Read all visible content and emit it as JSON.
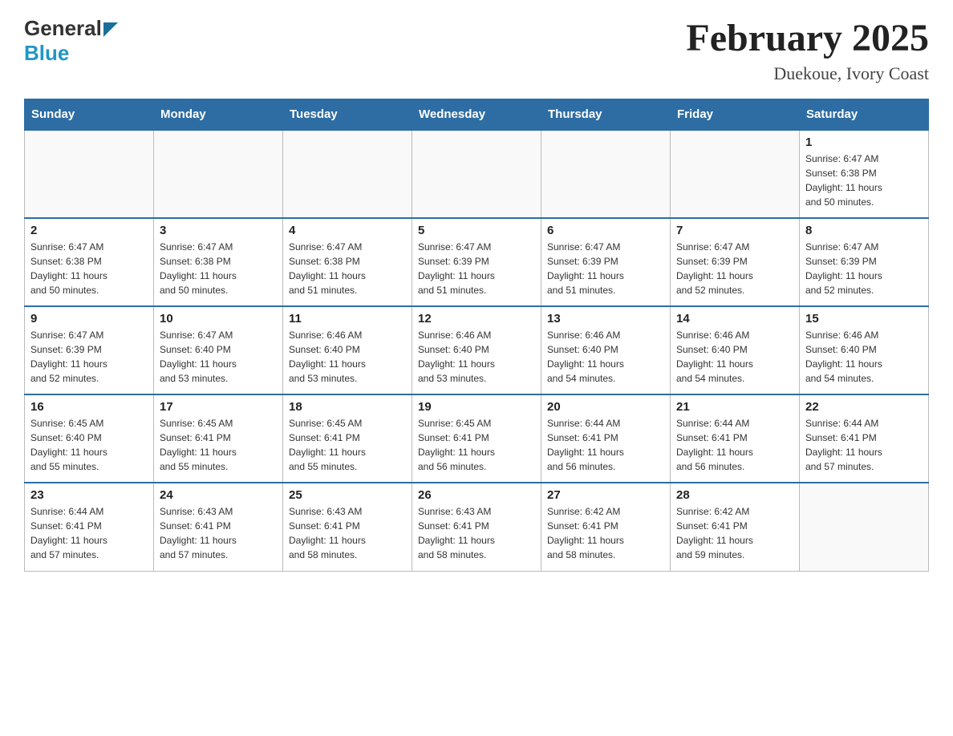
{
  "header": {
    "title": "February 2025",
    "subtitle": "Duekoue, Ivory Coast",
    "logo_general": "General",
    "logo_blue": "Blue"
  },
  "days_of_week": [
    "Sunday",
    "Monday",
    "Tuesday",
    "Wednesday",
    "Thursday",
    "Friday",
    "Saturday"
  ],
  "weeks": [
    {
      "days": [
        {
          "number": "",
          "info": ""
        },
        {
          "number": "",
          "info": ""
        },
        {
          "number": "",
          "info": ""
        },
        {
          "number": "",
          "info": ""
        },
        {
          "number": "",
          "info": ""
        },
        {
          "number": "",
          "info": ""
        },
        {
          "number": "1",
          "info": "Sunrise: 6:47 AM\nSunset: 6:38 PM\nDaylight: 11 hours\nand 50 minutes."
        }
      ]
    },
    {
      "days": [
        {
          "number": "2",
          "info": "Sunrise: 6:47 AM\nSunset: 6:38 PM\nDaylight: 11 hours\nand 50 minutes."
        },
        {
          "number": "3",
          "info": "Sunrise: 6:47 AM\nSunset: 6:38 PM\nDaylight: 11 hours\nand 50 minutes."
        },
        {
          "number": "4",
          "info": "Sunrise: 6:47 AM\nSunset: 6:38 PM\nDaylight: 11 hours\nand 51 minutes."
        },
        {
          "number": "5",
          "info": "Sunrise: 6:47 AM\nSunset: 6:39 PM\nDaylight: 11 hours\nand 51 minutes."
        },
        {
          "number": "6",
          "info": "Sunrise: 6:47 AM\nSunset: 6:39 PM\nDaylight: 11 hours\nand 51 minutes."
        },
        {
          "number": "7",
          "info": "Sunrise: 6:47 AM\nSunset: 6:39 PM\nDaylight: 11 hours\nand 52 minutes."
        },
        {
          "number": "8",
          "info": "Sunrise: 6:47 AM\nSunset: 6:39 PM\nDaylight: 11 hours\nand 52 minutes."
        }
      ]
    },
    {
      "days": [
        {
          "number": "9",
          "info": "Sunrise: 6:47 AM\nSunset: 6:39 PM\nDaylight: 11 hours\nand 52 minutes."
        },
        {
          "number": "10",
          "info": "Sunrise: 6:47 AM\nSunset: 6:40 PM\nDaylight: 11 hours\nand 53 minutes."
        },
        {
          "number": "11",
          "info": "Sunrise: 6:46 AM\nSunset: 6:40 PM\nDaylight: 11 hours\nand 53 minutes."
        },
        {
          "number": "12",
          "info": "Sunrise: 6:46 AM\nSunset: 6:40 PM\nDaylight: 11 hours\nand 53 minutes."
        },
        {
          "number": "13",
          "info": "Sunrise: 6:46 AM\nSunset: 6:40 PM\nDaylight: 11 hours\nand 54 minutes."
        },
        {
          "number": "14",
          "info": "Sunrise: 6:46 AM\nSunset: 6:40 PM\nDaylight: 11 hours\nand 54 minutes."
        },
        {
          "number": "15",
          "info": "Sunrise: 6:46 AM\nSunset: 6:40 PM\nDaylight: 11 hours\nand 54 minutes."
        }
      ]
    },
    {
      "days": [
        {
          "number": "16",
          "info": "Sunrise: 6:45 AM\nSunset: 6:40 PM\nDaylight: 11 hours\nand 55 minutes."
        },
        {
          "number": "17",
          "info": "Sunrise: 6:45 AM\nSunset: 6:41 PM\nDaylight: 11 hours\nand 55 minutes."
        },
        {
          "number": "18",
          "info": "Sunrise: 6:45 AM\nSunset: 6:41 PM\nDaylight: 11 hours\nand 55 minutes."
        },
        {
          "number": "19",
          "info": "Sunrise: 6:45 AM\nSunset: 6:41 PM\nDaylight: 11 hours\nand 56 minutes."
        },
        {
          "number": "20",
          "info": "Sunrise: 6:44 AM\nSunset: 6:41 PM\nDaylight: 11 hours\nand 56 minutes."
        },
        {
          "number": "21",
          "info": "Sunrise: 6:44 AM\nSunset: 6:41 PM\nDaylight: 11 hours\nand 56 minutes."
        },
        {
          "number": "22",
          "info": "Sunrise: 6:44 AM\nSunset: 6:41 PM\nDaylight: 11 hours\nand 57 minutes."
        }
      ]
    },
    {
      "days": [
        {
          "number": "23",
          "info": "Sunrise: 6:44 AM\nSunset: 6:41 PM\nDaylight: 11 hours\nand 57 minutes."
        },
        {
          "number": "24",
          "info": "Sunrise: 6:43 AM\nSunset: 6:41 PM\nDaylight: 11 hours\nand 57 minutes."
        },
        {
          "number": "25",
          "info": "Sunrise: 6:43 AM\nSunset: 6:41 PM\nDaylight: 11 hours\nand 58 minutes."
        },
        {
          "number": "26",
          "info": "Sunrise: 6:43 AM\nSunset: 6:41 PM\nDaylight: 11 hours\nand 58 minutes."
        },
        {
          "number": "27",
          "info": "Sunrise: 6:42 AM\nSunset: 6:41 PM\nDaylight: 11 hours\nand 58 minutes."
        },
        {
          "number": "28",
          "info": "Sunrise: 6:42 AM\nSunset: 6:41 PM\nDaylight: 11 hours\nand 59 minutes."
        },
        {
          "number": "",
          "info": ""
        }
      ]
    }
  ]
}
